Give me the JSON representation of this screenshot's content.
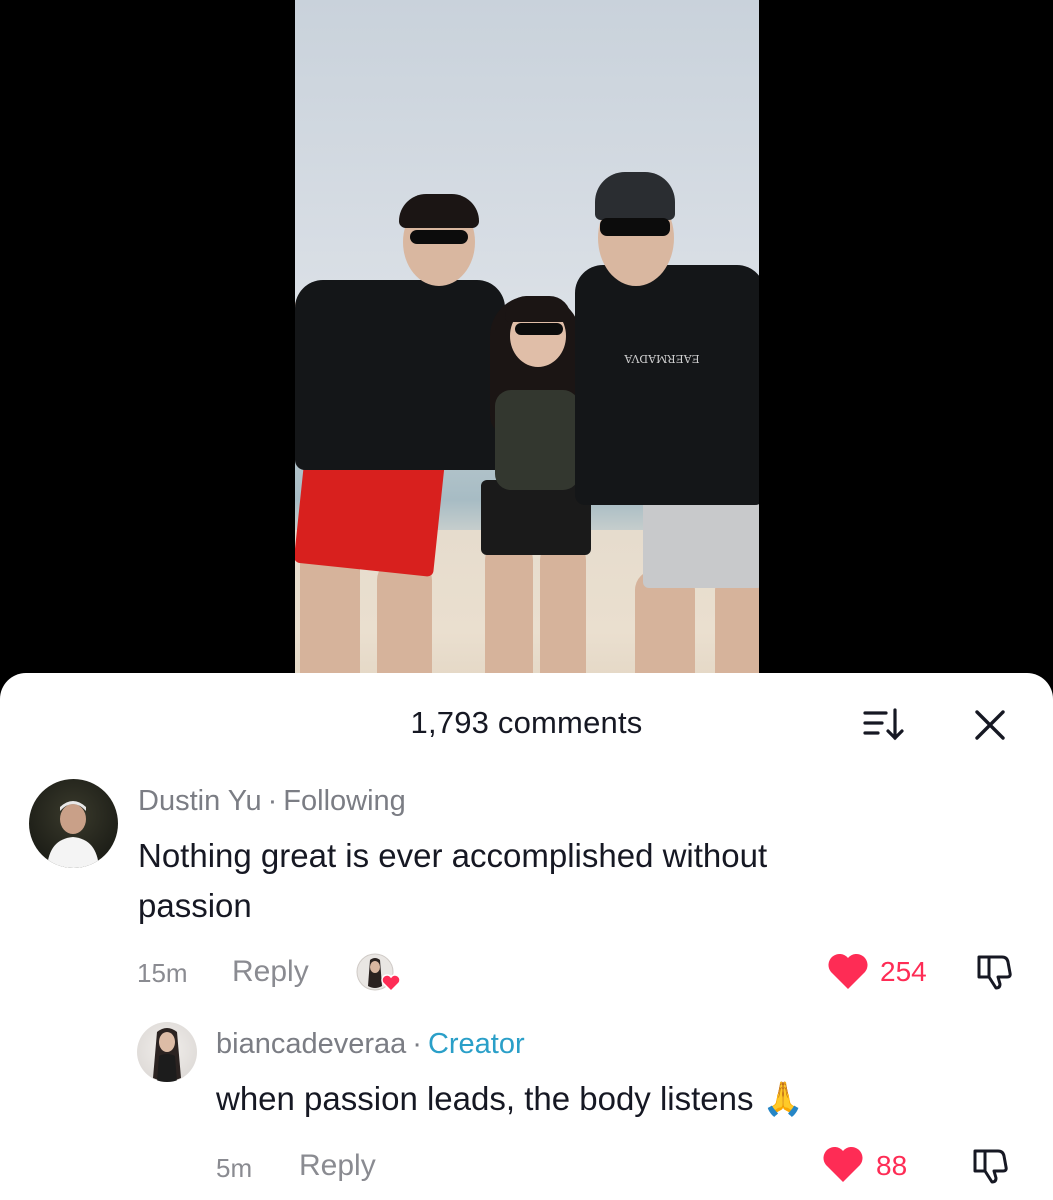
{
  "video": {
    "shirt_text": "EAERMADVA"
  },
  "comments_sheet": {
    "title": "1,793 comments",
    "sort_icon": "sort-icon",
    "close_icon": "close-icon"
  },
  "comments": [
    {
      "username": "Dustin Yu",
      "separator": "·",
      "tag": "Following",
      "text_line1": "Nothing great is ever accomplished without",
      "text_line2": "passion",
      "time": "15m",
      "reply_label": "Reply",
      "likes": "254",
      "liked_by_creator": true
    },
    {
      "username": "biancadeveraa",
      "separator": "·",
      "tag": "Creator",
      "text": "when passion leads, the body listens",
      "emoji": "🙏",
      "time": "5m",
      "reply_label": "Reply",
      "likes": "88"
    }
  ],
  "colors": {
    "like_red": "#fe2c55",
    "creator_blue": "#2a9fc8",
    "meta_gray": "#7b7d84"
  }
}
